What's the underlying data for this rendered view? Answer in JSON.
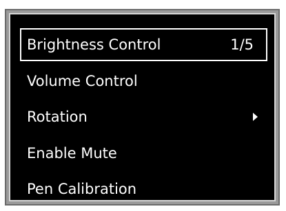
{
  "menu": {
    "items": [
      {
        "label": "Brightness Control",
        "value": "1/5",
        "selected": true
      },
      {
        "label": "Volume Control"
      },
      {
        "label": "Rotation",
        "icon": "chevron-right-icon"
      },
      {
        "label": "Enable Mute"
      },
      {
        "label": "Pen Calibration"
      }
    ]
  }
}
